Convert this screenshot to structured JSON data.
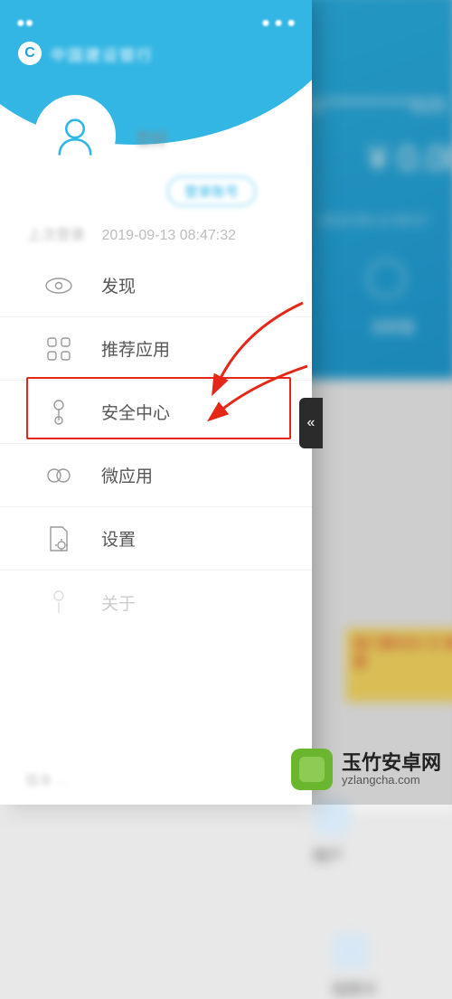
{
  "status": {
    "left_blob": "●●",
    "right_blob": "● ● ●"
  },
  "drawer": {
    "bank_name": "中国建设银行",
    "logo_letter": "C",
    "greeting": "您好",
    "badge": "登录账号",
    "last_login_label": "上次登录",
    "last_login_time": "2019-09-13 08:47:32"
  },
  "menu": {
    "items": [
      {
        "key": "discover",
        "label": "发现",
        "faded": false
      },
      {
        "key": "recommend",
        "label": "推荐应用",
        "faded": false
      },
      {
        "key": "security",
        "label": "安全中心",
        "faded": false
      },
      {
        "key": "microapp",
        "label": "微应用",
        "faded": false
      },
      {
        "key": "settings",
        "label": "设置",
        "faded": false
      },
      {
        "key": "about",
        "label": "关于",
        "faded": true
      }
    ]
  },
  "footer": {
    "text": "版本 ..."
  },
  "background": {
    "card_masked": "621***********829",
    "balance": "¥ 0.00",
    "time_blob": "2019-09-13 08:47",
    "icon_label": "龙财富",
    "tile1": "账户",
    "tile2": "信用卡",
    "promo": "首门票半价 万 博 惠"
  },
  "highlight": {
    "index": 2
  },
  "collapse_glyph": "«",
  "watermark": {
    "cn": "玉竹安卓网",
    "en": "yzlangcha.com"
  }
}
